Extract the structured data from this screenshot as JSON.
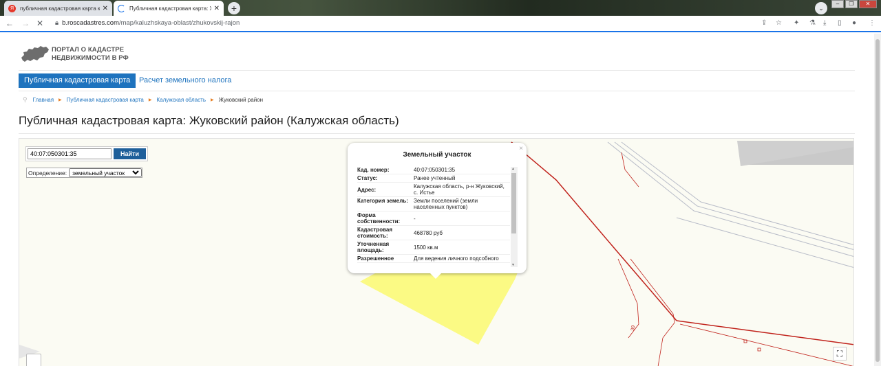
{
  "browser": {
    "tabs": [
      {
        "title": "публичная кадастровая карта к",
        "favicon": "yandex-icon"
      },
      {
        "title": "Публичная кадастровая карта: Ж",
        "favicon": "loading-icon"
      }
    ],
    "url_host": "b.roscadastres.com",
    "url_path": "/map/kaluzhskaya-oblast/zhukovskij-rajon"
  },
  "site": {
    "logo_line1": "ПОРТАЛ О КАДАСТРЕ",
    "logo_line2": "НЕДВИЖИМОСТИ В РФ"
  },
  "nav": {
    "active": "Публичная кадастровая карта",
    "link": "Расчет земельного налога"
  },
  "breadcrumbs": [
    "Главная",
    "Публичная кадастровая карта",
    "Калужская область",
    "Жуковский район"
  ],
  "page_title": "Публичная кадастровая карта: Жуковский район (Калужская область)",
  "map": {
    "search_value": "40:07:050301:35",
    "search_button": "Найти",
    "definition_label": "Определение:",
    "definition_value": "земельный участок",
    "label_39": "39",
    "plot_color": "#fbfa84",
    "boundary_color": "#c0211a",
    "popup": {
      "title": "Земельный участок",
      "close": "×",
      "rows": [
        {
          "key": "Кад. номер:",
          "value": "40:07:050301:35"
        },
        {
          "key": "Статус:",
          "value": "Ранее учтенный"
        },
        {
          "key": "Адрес:",
          "value": "Калужская область, р-н Жуковский, с. Истье"
        },
        {
          "key": "Категория земель:",
          "value": "Земли поселений (земли населенных пунктов)"
        },
        {
          "key": "Форма собственности:",
          "value": "-"
        },
        {
          "key": "Кадастровая стоимость:",
          "value": "468780 руб"
        },
        {
          "key": "Уточненная площадь:",
          "value": "1500 кв.м"
        },
        {
          "key": "Разрешенное",
          "value": "Для ведения личного подсобного"
        }
      ]
    }
  }
}
